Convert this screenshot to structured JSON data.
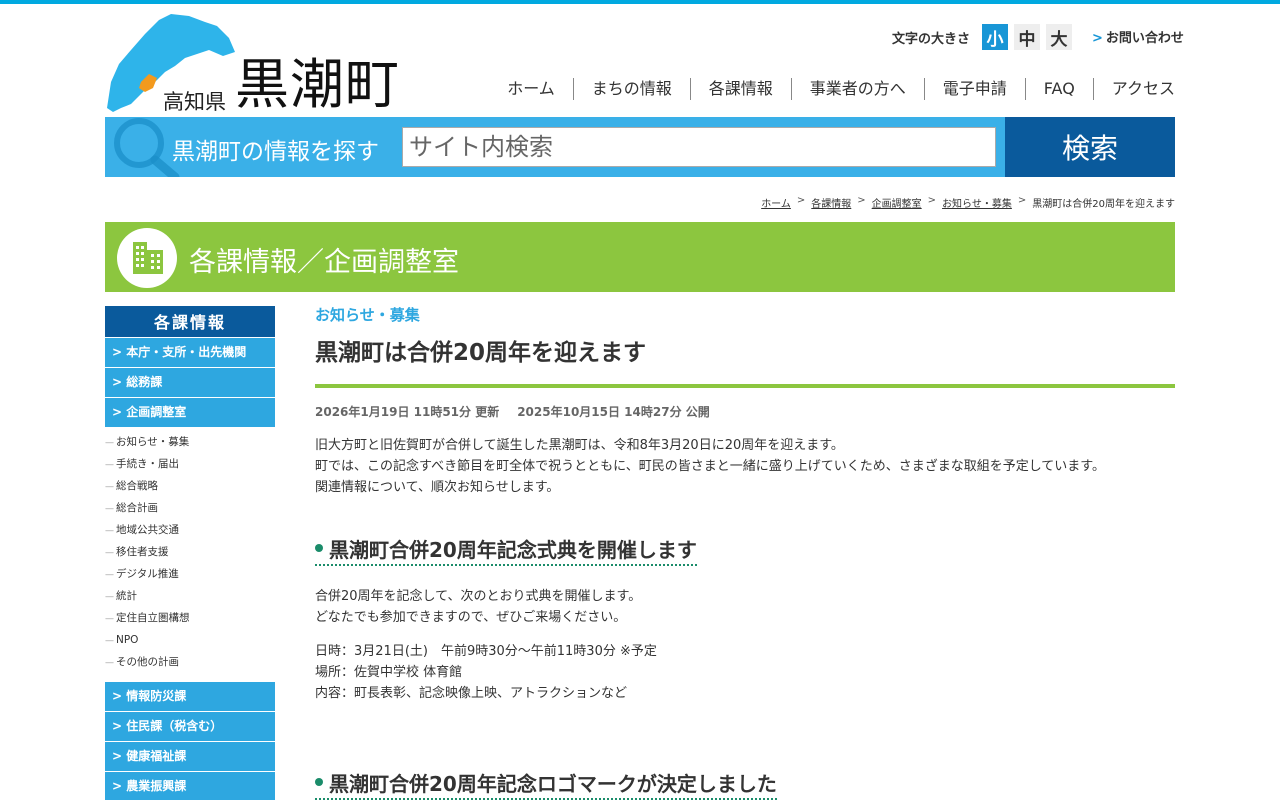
{
  "header": {
    "prefecture": "高知県",
    "town": "黒潮町",
    "fontsize_label": "文字の大きさ",
    "fontsize_options": [
      "小",
      "中",
      "大"
    ],
    "fontsize_active": "小",
    "contact": "お問い合わせ",
    "nav": [
      "ホーム",
      "まちの情報",
      "各課情報",
      "事業者の方へ",
      "電子申請",
      "FAQ",
      "アクセス"
    ]
  },
  "search": {
    "label": "黒潮町の情報を探す",
    "placeholder": "サイト内検索",
    "button": "検索"
  },
  "breadcrumb": [
    "ホーム",
    "各課情報",
    "企画調整室",
    "お知らせ・募集",
    "黒潮町は合併20周年を迎えます"
  ],
  "banner": {
    "title": "各課情報／企画調整室"
  },
  "sidebar": {
    "heading": "各課情報",
    "items_top": [
      "本庁・支所・出先機関",
      "総務課",
      "企画調整室"
    ],
    "sub_items": [
      "お知らせ・募集",
      "手続き・届出",
      "総合戦略",
      "総合計画",
      "地域公共交通",
      "移住者支援",
      "デジタル推進",
      "統計",
      "定住自立圏構想",
      "NPO",
      "その他の計画"
    ],
    "items_bottom": [
      "情報防災課",
      "住民課（税含む）",
      "健康福祉課",
      "農業振興課"
    ]
  },
  "article": {
    "category": "お知らせ・募集",
    "title": "黒潮町は合併20周年を迎えます",
    "updated": "2026年1月19日 11時51分 更新",
    "published": "2025年10月15日 14時27分 公開",
    "intro": [
      "旧大方町と旧佐賀町が合併して誕生した黒潮町は、令和8年3月20日に20周年を迎えます。",
      "町では、この記念すべき節目を町全体で祝うとともに、町民の皆さまと一緒に盛り上げていくため、さまざまな取組を予定しています。",
      "関連情報について、順次お知らせします。"
    ],
    "section1": {
      "heading": "黒潮町合併20周年記念式典を開催します",
      "lines": [
        "合併20周年を記念して、次のとおり式典を開催します。",
        "どなたでも参加できますので、ぜひご来場ください。"
      ],
      "details": [
        "日時：3月21日(土)　午前9時30分～午前11時30分 ※予定",
        "場所：佐賀中学校 体育館",
        "内容：町長表彰、記念映像上映、アトラクションなど"
      ]
    },
    "section2": {
      "heading": "黒潮町合併20周年記念ロゴマークが決定しました"
    }
  },
  "colors": {
    "accent_blue": "#1896d6",
    "search_blue": "#3ab0e8",
    "dark_blue": "#0a5a9c",
    "banner_green": "#8cc63f",
    "heading_teal": "#1a8c6a"
  }
}
